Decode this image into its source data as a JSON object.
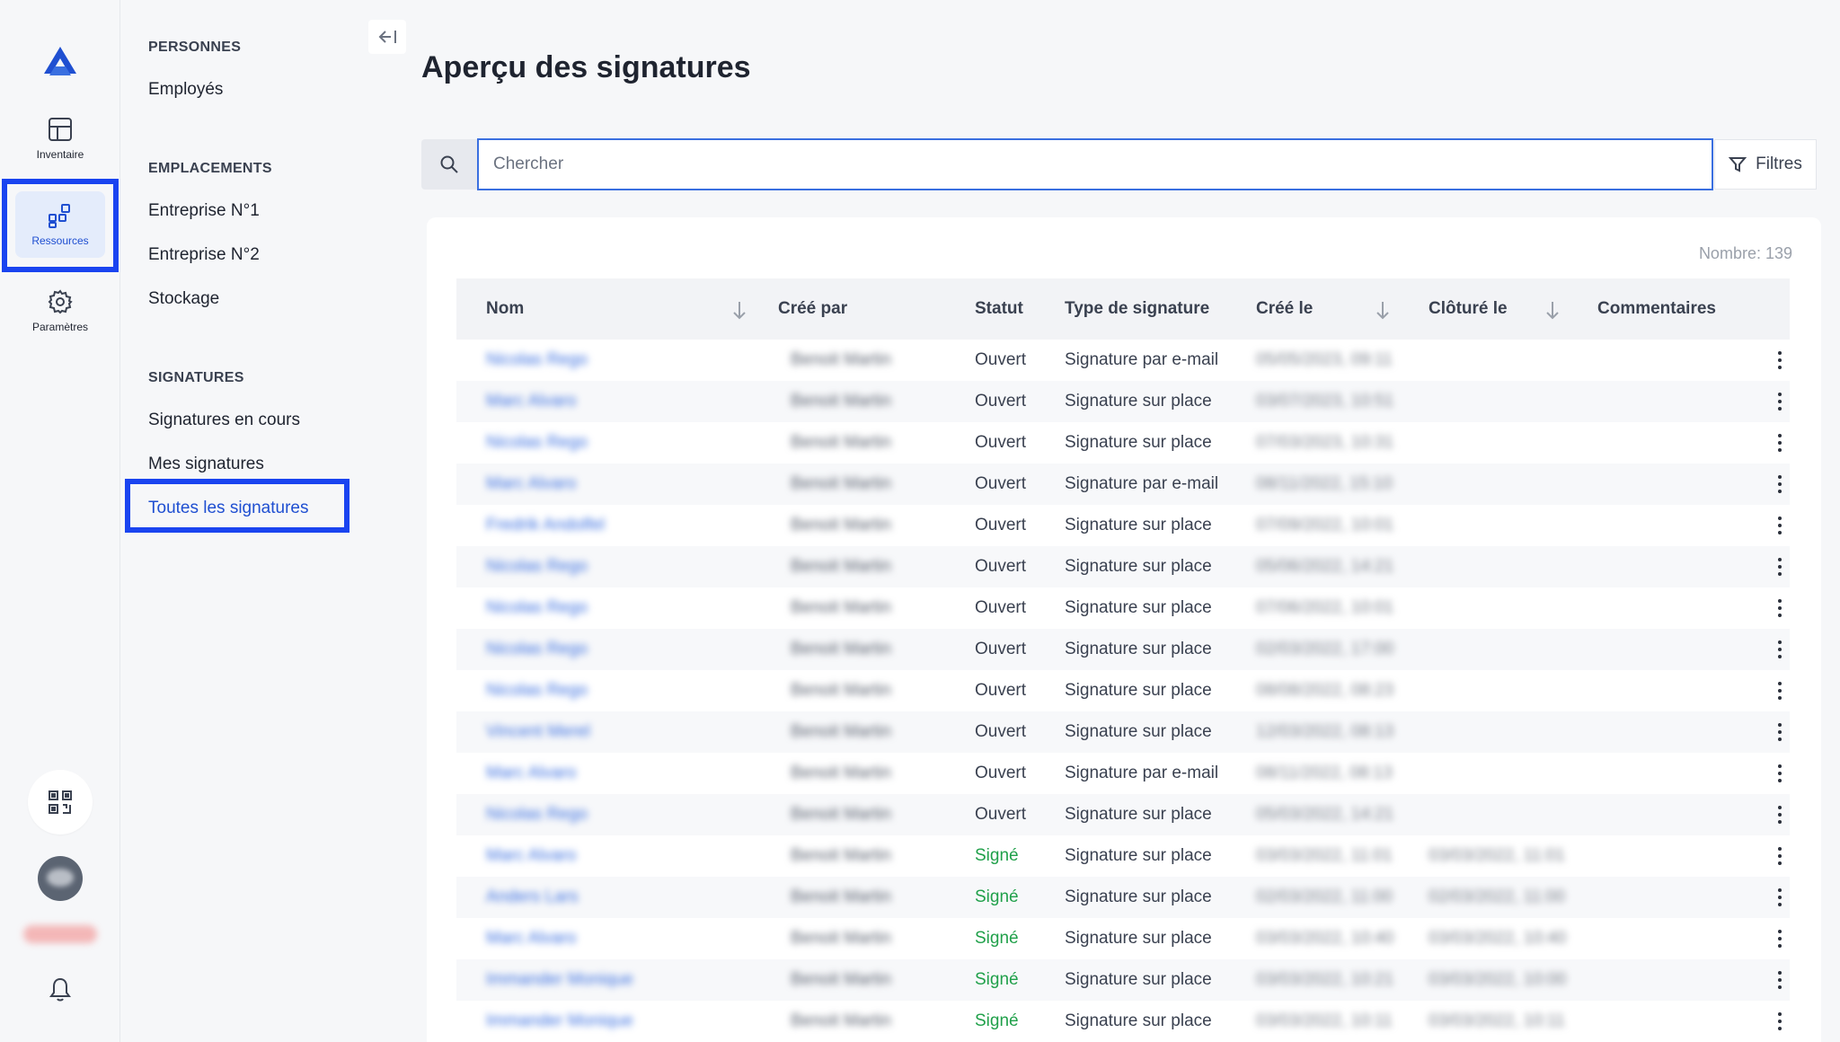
{
  "rail": {
    "items": [
      {
        "label": "Inventaire",
        "icon": "grid-icon"
      },
      {
        "label": "Ressources",
        "icon": "resources-icon"
      },
      {
        "label": "Paramètres",
        "icon": "gear-icon"
      }
    ]
  },
  "subnav": {
    "sections": [
      {
        "title": "PERSONNES",
        "items": [
          "Employés"
        ]
      },
      {
        "title": "EMPLACEMENTS",
        "items": [
          "Entreprise N°1",
          "Entreprise N°2",
          "Stockage"
        ]
      },
      {
        "title": "SIGNATURES",
        "items": [
          "Signatures en cours",
          "Mes signatures",
          "Toutes les signatures"
        ]
      }
    ],
    "active_item": "Toutes les signatures"
  },
  "main": {
    "title": "Aperçu des signatures",
    "search": {
      "placeholder": "Chercher",
      "value": ""
    },
    "filters_label": "Filtres",
    "count_label": "Nombre: 139",
    "columns": [
      "Nom",
      "Créé par",
      "Statut",
      "Type de signature",
      "Créé le",
      "Clôturé le",
      "Commentaires"
    ],
    "rows": [
      {
        "name": "Nicolas Rego",
        "created_by": "Benoit Martin",
        "status": "Ouvert",
        "type": "Signature par e-mail",
        "created": "05/05/2023, 09:11",
        "closed": ""
      },
      {
        "name": "Marc Alvaro",
        "created_by": "Benoit Martin",
        "status": "Ouvert",
        "type": "Signature sur place",
        "created": "03/07/2023, 10:51",
        "closed": ""
      },
      {
        "name": "Nicolas Rego",
        "created_by": "Benoit Martin",
        "status": "Ouvert",
        "type": "Signature sur place",
        "created": "07/03/2023, 10:31",
        "closed": ""
      },
      {
        "name": "Marc Alvaro",
        "created_by": "Benoit Martin",
        "status": "Ouvert",
        "type": "Signature par e-mail",
        "created": "08/11/2022, 15:10",
        "closed": ""
      },
      {
        "name": "Fredrik Andolfel",
        "created_by": "Benoit Martin",
        "status": "Ouvert",
        "type": "Signature sur place",
        "created": "07/09/2022, 10:01",
        "closed": ""
      },
      {
        "name": "Nicolas Rego",
        "created_by": "Benoit Martin",
        "status": "Ouvert",
        "type": "Signature sur place",
        "created": "05/06/2022, 14:21",
        "closed": ""
      },
      {
        "name": "Nicolas Rego",
        "created_by": "Benoit Martin",
        "status": "Ouvert",
        "type": "Signature sur place",
        "created": "07/06/2022, 10:01",
        "closed": ""
      },
      {
        "name": "Nicolas Rego",
        "created_by": "Benoit Martin",
        "status": "Ouvert",
        "type": "Signature sur place",
        "created": "02/03/2022, 17:00",
        "closed": ""
      },
      {
        "name": "Nicolas Rego",
        "created_by": "Benoit Martin",
        "status": "Ouvert",
        "type": "Signature sur place",
        "created": "08/08/2022, 08:23",
        "closed": ""
      },
      {
        "name": "Vincent Merel",
        "created_by": "Benoit Martin",
        "status": "Ouvert",
        "type": "Signature sur place",
        "created": "12/03/2022, 08:13",
        "closed": ""
      },
      {
        "name": "Marc Alvaro",
        "created_by": "Benoit Martin",
        "status": "Ouvert",
        "type": "Signature par e-mail",
        "created": "08/11/2022, 08:13",
        "closed": ""
      },
      {
        "name": "Nicolas Rego",
        "created_by": "Benoit Martin",
        "status": "Ouvert",
        "type": "Signature sur place",
        "created": "05/03/2022, 14:21",
        "closed": ""
      },
      {
        "name": "Marc Alvaro",
        "created_by": "Benoit Martin",
        "status": "Signé",
        "type": "Signature sur place",
        "created": "03/03/2022, 11:01",
        "closed": "03/03/2022, 11:01"
      },
      {
        "name": "Anders Lars",
        "created_by": "Benoit Martin",
        "status": "Signé",
        "type": "Signature sur place",
        "created": "02/03/2022, 11:00",
        "closed": "02/03/2022, 11:00"
      },
      {
        "name": "Marc Alvaro",
        "created_by": "Benoit Martin",
        "status": "Signé",
        "type": "Signature sur place",
        "created": "03/03/2022, 10:40",
        "closed": "03/03/2022, 10:40"
      },
      {
        "name": "Immander Monique",
        "created_by": "Benoit Martin",
        "status": "Signé",
        "type": "Signature sur place",
        "created": "03/03/2022, 10:21",
        "closed": "03/03/2022, 10:00"
      },
      {
        "name": "Immander Monique",
        "created_by": "Benoit Martin",
        "status": "Signé",
        "type": "Signature sur place",
        "created": "03/03/2022, 10:11",
        "closed": "03/03/2022, 10:11"
      }
    ]
  },
  "colors": {
    "accent": "#1f4fd1",
    "highlight": "#1a44f0",
    "signed": "#20a04a",
    "link": "#3a6fe0"
  }
}
